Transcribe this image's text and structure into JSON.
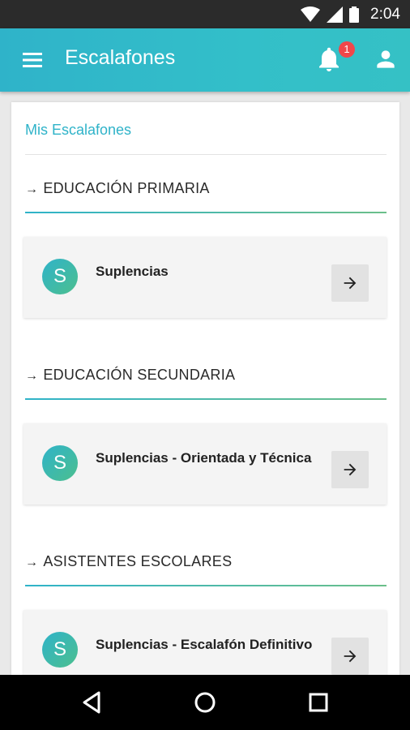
{
  "status_bar": {
    "time": "2:04",
    "icons": [
      "wifi-icon",
      "cell-signal-icon",
      "battery-icon"
    ]
  },
  "app_bar": {
    "title": "Escalafones",
    "notification_count": "1",
    "icons": [
      "menu-icon",
      "bell-icon",
      "account-icon"
    ]
  },
  "main": {
    "subtitle": "Mis Escalafones",
    "sections": [
      {
        "heading": "EDUCACIÓN PRIMARIA",
        "item": {
          "avatar_letter": "S",
          "label": "Suplencias"
        }
      },
      {
        "heading": "EDUCACIÓN SECUNDARIA",
        "item": {
          "avatar_letter": "S",
          "label": "Suplencias - Orientada y Técnica"
        }
      },
      {
        "heading": "ASISTENTES ESCOLARES",
        "item": {
          "avatar_letter": "S",
          "label": "Suplencias - Escalafón Definitivo"
        }
      }
    ]
  },
  "colors": {
    "primary": "#2fb3c9",
    "accent_green": "#6bbf8a",
    "badge": "#f0474a"
  },
  "nav_bar": {
    "icons": [
      "back-icon",
      "home-icon",
      "recents-icon"
    ]
  }
}
